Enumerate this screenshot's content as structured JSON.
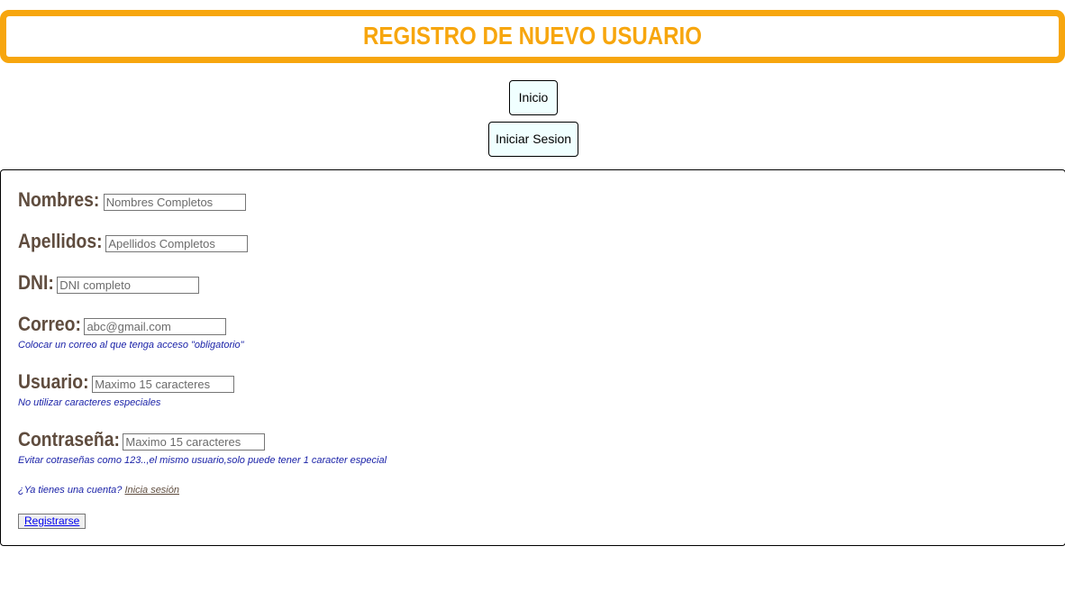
{
  "header": {
    "title": "REGISTRO DE NUEVO USUARIO",
    "accent_color": "#f7a60e"
  },
  "nav": {
    "home_label": "Inicio",
    "login_label": "Iniciar Sesion"
  },
  "form": {
    "fields": {
      "nombres": {
        "label": "Nombres:",
        "placeholder": "Nombres Completos",
        "value": ""
      },
      "apellidos": {
        "label": "Apellidos:",
        "placeholder": "Apellidos Completos",
        "value": ""
      },
      "dni": {
        "label": "DNI:",
        "placeholder": "DNI completo",
        "value": ""
      },
      "correo": {
        "label": "Correo:",
        "placeholder": "abc@gmail.com",
        "value": "",
        "hint": "Colocar un correo al que tenga acceso \"obligatorio\""
      },
      "usuario": {
        "label": "Usuario:",
        "placeholder": "Maximo 15 caracteres",
        "value": "",
        "hint": "No utilizar caracteres especiales"
      },
      "contrasena": {
        "label": "Contraseña:",
        "placeholder": "Maximo 15 caracteres",
        "value": "",
        "hint": "Evitar cotraseñas como 123..,el mismo usuario,solo puede tener 1 caracter especial"
      }
    },
    "account_prompt": "¿Ya tienes una cuenta?",
    "account_link": "Inicia sesión",
    "submit_label": "Registrarse",
    "label_color": "#5f4c3e",
    "hint_color": "#1a22a8"
  }
}
